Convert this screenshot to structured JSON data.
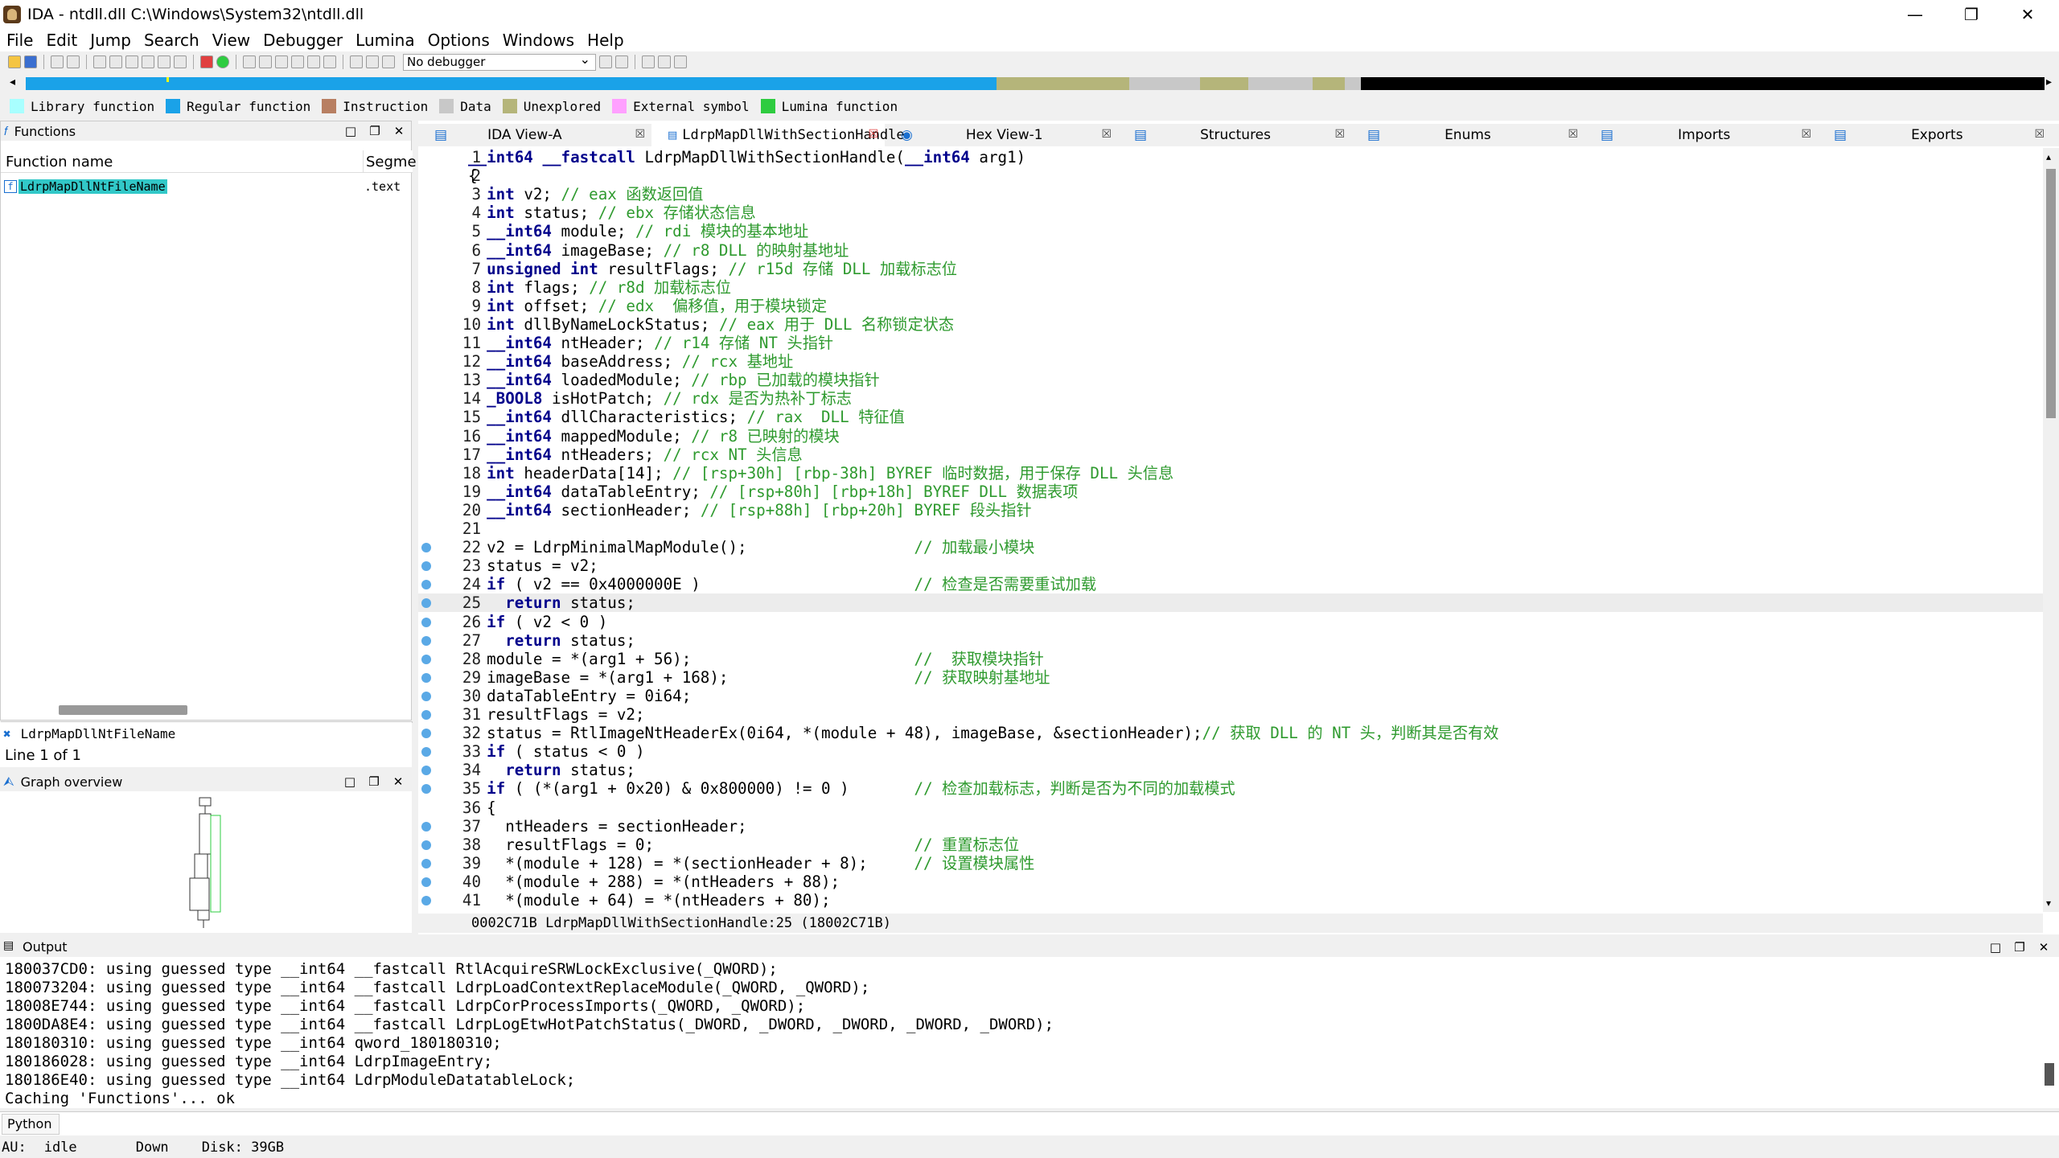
{
  "window": {
    "title": "IDA - ntdll.dll C:\\Windows\\System32\\ntdll.dll"
  },
  "menu": [
    "File",
    "Edit",
    "Jump",
    "Search",
    "View",
    "Debugger",
    "Lumina",
    "Options",
    "Windows",
    "Help"
  ],
  "toolbar": {
    "debugger_select": "No debugger"
  },
  "legend": [
    {
      "label": "Library function",
      "color": "#a8ffff"
    },
    {
      "label": "Regular function",
      "color": "#1aa2e8"
    },
    {
      "label": "Instruction",
      "color": "#b87f62"
    },
    {
      "label": "Data",
      "color": "#c8c8c8"
    },
    {
      "label": "Unexplored",
      "color": "#b5b57a"
    },
    {
      "label": "External symbol",
      "color": "#ffa0ff"
    },
    {
      "label": "Lumina function",
      "color": "#2ecc40"
    }
  ],
  "functions_panel": {
    "title": "Functions",
    "col_name": "Function name",
    "col_segment": "Segme",
    "rows": [
      {
        "name": "LdrpMapDllNtFileName",
        "segment": ".text"
      }
    ],
    "footer_name": "LdrpMapDllNtFileName",
    "line_info": "Line 1 of 1"
  },
  "graph_overview": {
    "title": "Graph overview"
  },
  "tabs": [
    {
      "label": "IDA View-A"
    },
    {
      "label": "LdrpMapDllWithSectionHandle"
    },
    {
      "label": "Hex View-1"
    },
    {
      "label": "Structures"
    },
    {
      "label": "Enums"
    },
    {
      "label": "Imports"
    },
    {
      "label": "Exports"
    }
  ],
  "code": {
    "lines": [
      {
        "n": "1",
        "t": "__int64 __fastcall LdrpMapDllWithSectionHandle(__int64 arg1)",
        "bp": false
      },
      {
        "n": "2",
        "t": "{",
        "bp": false
      },
      {
        "n": "3",
        "t": "  int v2; // eax 函数返回值",
        "bp": false
      },
      {
        "n": "4",
        "t": "  int status; // ebx 存储状态信息",
        "bp": false
      },
      {
        "n": "5",
        "t": "  __int64 module; // rdi 模块的基本地址",
        "bp": false
      },
      {
        "n": "6",
        "t": "  __int64 imageBase; // r8 DLL 的映射基地址",
        "bp": false
      },
      {
        "n": "7",
        "t": "  unsigned int resultFlags; // r15d 存储 DLL 加载标志位",
        "bp": false
      },
      {
        "n": "8",
        "t": "  int flags; // r8d 加载标志位",
        "bp": false
      },
      {
        "n": "9",
        "t": "  int offset; // edx  偏移值，用于模块锁定",
        "bp": false
      },
      {
        "n": "10",
        "t": "  int dllByNameLockStatus; // eax 用于 DLL 名称锁定状态",
        "bp": false
      },
      {
        "n": "11",
        "t": "  __int64 ntHeader; // r14 存储 NT 头指针",
        "bp": false
      },
      {
        "n": "12",
        "t": "  __int64 baseAddress; // rcx 基地址",
        "bp": false
      },
      {
        "n": "13",
        "t": "  __int64 loadedModule; // rbp 已加载的模块指针",
        "bp": false
      },
      {
        "n": "14",
        "t": "  _BOOL8 isHotPatch; // rdx 是否为热补丁标志",
        "bp": false
      },
      {
        "n": "15",
        "t": "  __int64 dllCharacteristics; // rax  DLL 特征值",
        "bp": false
      },
      {
        "n": "16",
        "t": "  __int64 mappedModule; // r8 已映射的模块",
        "bp": false
      },
      {
        "n": "17",
        "t": "  __int64 ntHeaders; // rcx NT 头信息",
        "bp": false
      },
      {
        "n": "18",
        "t": "  int headerData[14]; // [rsp+30h] [rbp-38h] BYREF 临时数据，用于保存 DLL 头信息",
        "bp": false
      },
      {
        "n": "19",
        "t": "  __int64 dataTableEntry; // [rsp+80h] [rbp+18h] BYREF DLL 数据表项",
        "bp": false
      },
      {
        "n": "20",
        "t": "  __int64 sectionHeader; // [rsp+88h] [rbp+20h] BYREF 段头指针",
        "bp": false
      },
      {
        "n": "21",
        "t": "",
        "bp": false
      },
      {
        "n": "22",
        "t": "  v2 = LdrpMinimalMapModule();                  // 加载最小模块",
        "bp": true
      },
      {
        "n": "23",
        "t": "  status = v2;",
        "bp": true
      },
      {
        "n": "24",
        "t": "  if ( v2 == 0x4000000E )                       // 检查是否需要重试加载",
        "bp": true
      },
      {
        "n": "25",
        "t": "    return status;",
        "bp": true
      },
      {
        "n": "26",
        "t": "  if ( v2 < 0 )",
        "bp": true
      },
      {
        "n": "27",
        "t": "    return status;",
        "bp": true
      },
      {
        "n": "28",
        "t": "  module = *(arg1 + 56);                        //  获取模块指针",
        "bp": true
      },
      {
        "n": "29",
        "t": "  imageBase = *(arg1 + 168);                    // 获取映射基地址",
        "bp": true
      },
      {
        "n": "30",
        "t": "  dataTableEntry = 0i64;",
        "bp": true
      },
      {
        "n": "31",
        "t": "  resultFlags = v2;",
        "bp": true
      },
      {
        "n": "32",
        "t": "  status = RtlImageNtHeaderEx(0i64, *(module + 48), imageBase, &sectionHeader);// 获取 DLL 的 NT 头，判断其是否有效",
        "bp": true
      },
      {
        "n": "33",
        "t": "  if ( status < 0 )",
        "bp": true
      },
      {
        "n": "34",
        "t": "    return status;",
        "bp": true
      },
      {
        "n": "35",
        "t": "  if ( (*(arg1 + 0x20) & 0x800000) != 0 )       // 检查加载标志，判断是否为不同的加载模式",
        "bp": true
      },
      {
        "n": "36",
        "t": "  {",
        "bp": false
      },
      {
        "n": "37",
        "t": "    ntHeaders = sectionHeader;",
        "bp": true
      },
      {
        "n": "38",
        "t": "    resultFlags = 0;                            // 重置标志位",
        "bp": true
      },
      {
        "n": "39",
        "t": "    *(module + 128) = *(sectionHeader + 8);     // 设置模块属性",
        "bp": true
      },
      {
        "n": "40",
        "t": "    *(module + 288) = *(ntHeaders + 88);",
        "bp": true
      },
      {
        "n": "41",
        "t": "    *(module + 64) = *(ntHeaders + 80);",
        "bp": true
      }
    ],
    "status_line": "0002C71B LdrpMapDllWithSectionHandle:25 (18002C71B)"
  },
  "output": {
    "title": "Output",
    "lines": [
      "180037CD0: using guessed type __int64 __fastcall RtlAcquireSRWLockExclusive(_QWORD);",
      "180073204: using guessed type __int64 __fastcall LdrpLoadContextReplaceModule(_QWORD, _QWORD);",
      "18008E744: using guessed type __int64 __fastcall LdrpCorProcessImports(_QWORD, _QWORD);",
      "1800DA8E4: using guessed type __int64 __fastcall LdrpLogEtwHotPatchStatus(_DWORD, _DWORD, _DWORD, _DWORD, _DWORD);",
      "180180310: using guessed type __int64 qword_180180310;",
      "180186028: using guessed type __int64 LdrpImageEntry;",
      "180186E40: using guessed type __int64 LdrpModuleDatatableLock;",
      "Caching 'Functions'... ok"
    ],
    "python_label": "Python"
  },
  "statusbar": {
    "au_label": "AU:",
    "au_state": "idle",
    "direction": "Down",
    "disk": "Disk: 39GB"
  }
}
